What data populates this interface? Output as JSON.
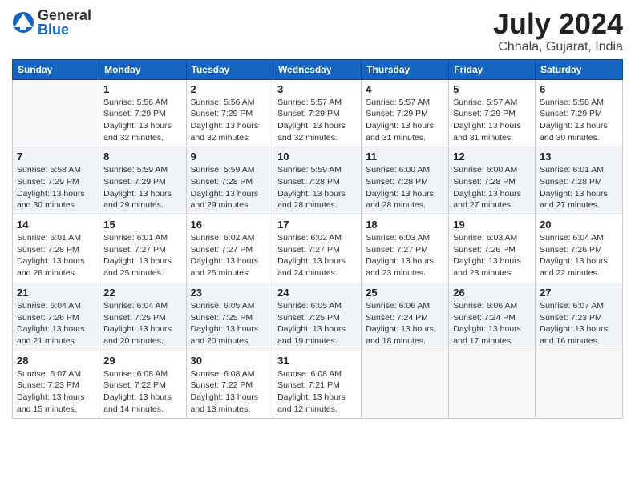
{
  "logo": {
    "general": "General",
    "blue": "Blue"
  },
  "title": "July 2024",
  "location": "Chhala, Gujarat, India",
  "headers": [
    "Sunday",
    "Monday",
    "Tuesday",
    "Wednesday",
    "Thursday",
    "Friday",
    "Saturday"
  ],
  "weeks": [
    [
      {
        "day": "",
        "info": ""
      },
      {
        "day": "1",
        "info": "Sunrise: 5:56 AM\nSunset: 7:29 PM\nDaylight: 13 hours\nand 32 minutes."
      },
      {
        "day": "2",
        "info": "Sunrise: 5:56 AM\nSunset: 7:29 PM\nDaylight: 13 hours\nand 32 minutes."
      },
      {
        "day": "3",
        "info": "Sunrise: 5:57 AM\nSunset: 7:29 PM\nDaylight: 13 hours\nand 32 minutes."
      },
      {
        "day": "4",
        "info": "Sunrise: 5:57 AM\nSunset: 7:29 PM\nDaylight: 13 hours\nand 31 minutes."
      },
      {
        "day": "5",
        "info": "Sunrise: 5:57 AM\nSunset: 7:29 PM\nDaylight: 13 hours\nand 31 minutes."
      },
      {
        "day": "6",
        "info": "Sunrise: 5:58 AM\nSunset: 7:29 PM\nDaylight: 13 hours\nand 30 minutes."
      }
    ],
    [
      {
        "day": "7",
        "info": "Sunrise: 5:58 AM\nSunset: 7:29 PM\nDaylight: 13 hours\nand 30 minutes."
      },
      {
        "day": "8",
        "info": "Sunrise: 5:59 AM\nSunset: 7:29 PM\nDaylight: 13 hours\nand 29 minutes."
      },
      {
        "day": "9",
        "info": "Sunrise: 5:59 AM\nSunset: 7:28 PM\nDaylight: 13 hours\nand 29 minutes."
      },
      {
        "day": "10",
        "info": "Sunrise: 5:59 AM\nSunset: 7:28 PM\nDaylight: 13 hours\nand 28 minutes."
      },
      {
        "day": "11",
        "info": "Sunrise: 6:00 AM\nSunset: 7:28 PM\nDaylight: 13 hours\nand 28 minutes."
      },
      {
        "day": "12",
        "info": "Sunrise: 6:00 AM\nSunset: 7:28 PM\nDaylight: 13 hours\nand 27 minutes."
      },
      {
        "day": "13",
        "info": "Sunrise: 6:01 AM\nSunset: 7:28 PM\nDaylight: 13 hours\nand 27 minutes."
      }
    ],
    [
      {
        "day": "14",
        "info": "Sunrise: 6:01 AM\nSunset: 7:28 PM\nDaylight: 13 hours\nand 26 minutes."
      },
      {
        "day": "15",
        "info": "Sunrise: 6:01 AM\nSunset: 7:27 PM\nDaylight: 13 hours\nand 25 minutes."
      },
      {
        "day": "16",
        "info": "Sunrise: 6:02 AM\nSunset: 7:27 PM\nDaylight: 13 hours\nand 25 minutes."
      },
      {
        "day": "17",
        "info": "Sunrise: 6:02 AM\nSunset: 7:27 PM\nDaylight: 13 hours\nand 24 minutes."
      },
      {
        "day": "18",
        "info": "Sunrise: 6:03 AM\nSunset: 7:27 PM\nDaylight: 13 hours\nand 23 minutes."
      },
      {
        "day": "19",
        "info": "Sunrise: 6:03 AM\nSunset: 7:26 PM\nDaylight: 13 hours\nand 23 minutes."
      },
      {
        "day": "20",
        "info": "Sunrise: 6:04 AM\nSunset: 7:26 PM\nDaylight: 13 hours\nand 22 minutes."
      }
    ],
    [
      {
        "day": "21",
        "info": "Sunrise: 6:04 AM\nSunset: 7:26 PM\nDaylight: 13 hours\nand 21 minutes."
      },
      {
        "day": "22",
        "info": "Sunrise: 6:04 AM\nSunset: 7:25 PM\nDaylight: 13 hours\nand 20 minutes."
      },
      {
        "day": "23",
        "info": "Sunrise: 6:05 AM\nSunset: 7:25 PM\nDaylight: 13 hours\nand 20 minutes."
      },
      {
        "day": "24",
        "info": "Sunrise: 6:05 AM\nSunset: 7:25 PM\nDaylight: 13 hours\nand 19 minutes."
      },
      {
        "day": "25",
        "info": "Sunrise: 6:06 AM\nSunset: 7:24 PM\nDaylight: 13 hours\nand 18 minutes."
      },
      {
        "day": "26",
        "info": "Sunrise: 6:06 AM\nSunset: 7:24 PM\nDaylight: 13 hours\nand 17 minutes."
      },
      {
        "day": "27",
        "info": "Sunrise: 6:07 AM\nSunset: 7:23 PM\nDaylight: 13 hours\nand 16 minutes."
      }
    ],
    [
      {
        "day": "28",
        "info": "Sunrise: 6:07 AM\nSunset: 7:23 PM\nDaylight: 13 hours\nand 15 minutes."
      },
      {
        "day": "29",
        "info": "Sunrise: 6:08 AM\nSunset: 7:22 PM\nDaylight: 13 hours\nand 14 minutes."
      },
      {
        "day": "30",
        "info": "Sunrise: 6:08 AM\nSunset: 7:22 PM\nDaylight: 13 hours\nand 13 minutes."
      },
      {
        "day": "31",
        "info": "Sunrise: 6:08 AM\nSunset: 7:21 PM\nDaylight: 13 hours\nand 12 minutes."
      },
      {
        "day": "",
        "info": ""
      },
      {
        "day": "",
        "info": ""
      },
      {
        "day": "",
        "info": ""
      }
    ]
  ]
}
